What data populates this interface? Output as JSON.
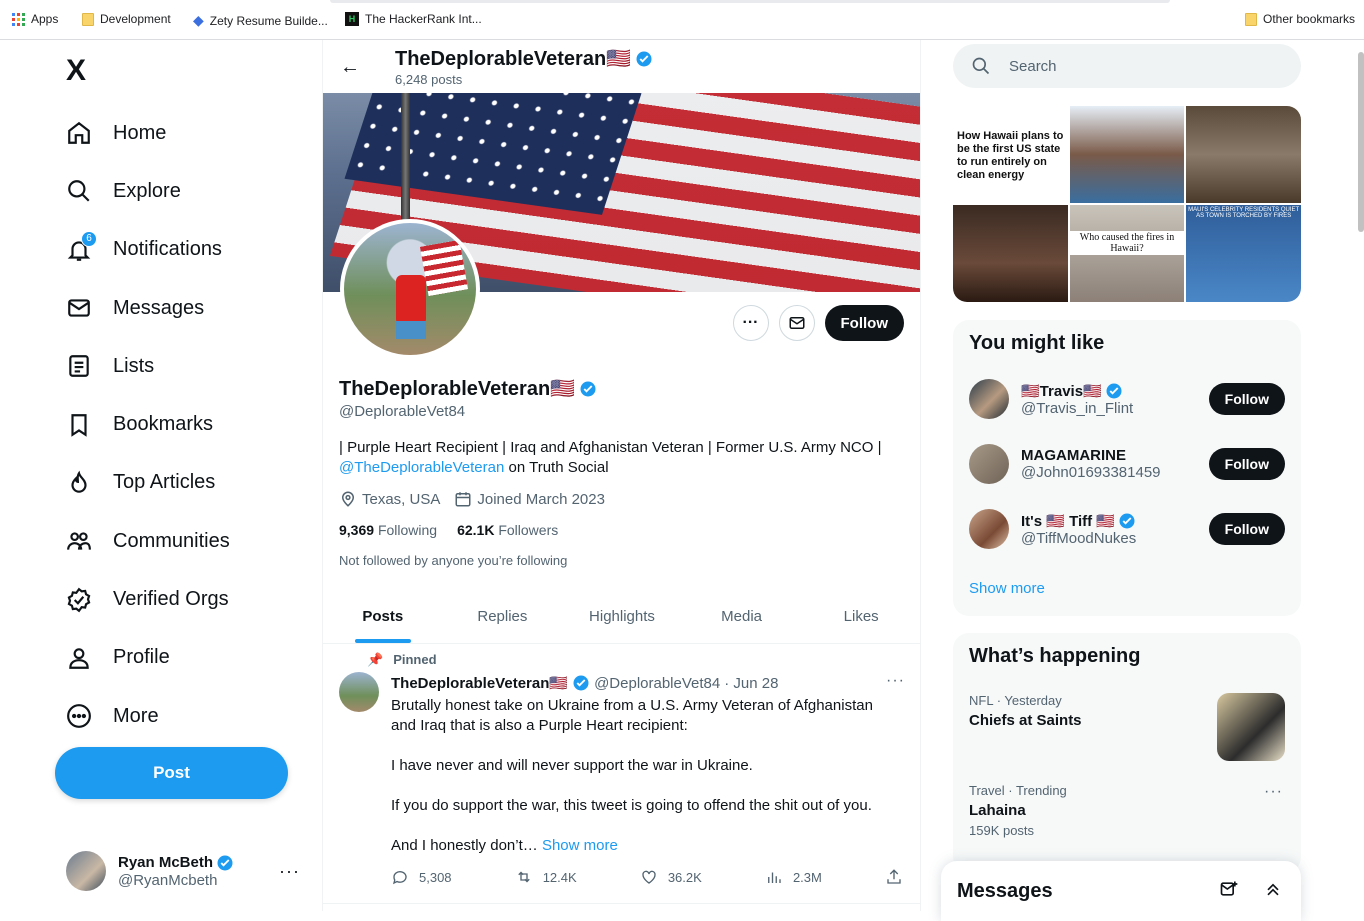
{
  "bookmarks": {
    "apps": "Apps",
    "items": [
      "Development",
      "Zety Resume Builde...",
      "The HackerRank Int..."
    ],
    "other": "Other bookmarks"
  },
  "sidebar": {
    "logo": "X",
    "nav": [
      {
        "label": "Home",
        "icon": "home-icon"
      },
      {
        "label": "Explore",
        "icon": "search-icon"
      },
      {
        "label": "Notifications",
        "icon": "bell-icon",
        "badge": "6"
      },
      {
        "label": "Messages",
        "icon": "mail-icon"
      },
      {
        "label": "Lists",
        "icon": "list-icon"
      },
      {
        "label": "Bookmarks",
        "icon": "bookmark-icon"
      },
      {
        "label": "Top Articles",
        "icon": "flame-icon"
      },
      {
        "label": "Communities",
        "icon": "people-icon"
      },
      {
        "label": "Verified Orgs",
        "icon": "verified-badge-icon"
      },
      {
        "label": "Profile",
        "icon": "person-icon"
      },
      {
        "label": "More",
        "icon": "more-circle-icon"
      }
    ],
    "post_label": "Post",
    "account": {
      "name": "Ryan McBeth",
      "handle": "@RyanMcbeth"
    }
  },
  "header": {
    "name": "TheDeplorableVeteran🇺🇸",
    "posts": "6,248 posts"
  },
  "profile": {
    "name": "TheDeplorableVeteran🇺🇸",
    "handle": "@DeplorableVet84",
    "bio_line1": "| Purple Heart Recipient | Iraq and Afghanistan Veteran | Former U.S. Army NCO |",
    "bio_link": "@TheDeplorableVeteran",
    "bio_suffix": " on Truth Social",
    "location": "Texas, USA",
    "joined": "Joined March 2023",
    "following_count": "9,369",
    "following_label": "Following",
    "followers_count": "62.1K",
    "followers_label": "Followers",
    "not_followed": "Not followed by anyone you’re following",
    "follow_label": "Follow"
  },
  "tabs": [
    "Posts",
    "Replies",
    "Highlights",
    "Media",
    "Likes"
  ],
  "tweet": {
    "pinned": "Pinned",
    "name": "TheDeplorableVeteran🇺🇸",
    "handle": "@DeplorableVet84",
    "date": "· Jun 28",
    "text": "Brutally honest take on Ukraine from a U.S. Army Veteran of Afghanistan and Iraq that is also a Purple Heart recipient:\n\nI have never and will never support the war in Ukraine.\n\nIf you do support the war, this tweet is going to offend the shit out of you.\n\nAnd I honestly don’t…",
    "show_more": "Show more",
    "replies": "5,308",
    "reposts": "12.4K",
    "likes": "36.2K",
    "views": "2.3M"
  },
  "right": {
    "search_placeholder": "Search",
    "media_text1": "How Hawaii plans to be the first US state to run entirely on clean energy",
    "media_text2": "Who caused the fires in Hawaii?",
    "media_text3": "MAUI'S CELEBRITY RESIDENTS QUIET AS TOWN IS TORCHED BY FIRES",
    "wtf_title": "You might like",
    "wtf": [
      {
        "name": "🇺🇸Travis🇺🇸",
        "handle": "@Travis_in_Flint",
        "verified": true
      },
      {
        "name": "MAGAMARINE",
        "handle": "@John01693381459",
        "verified": false
      },
      {
        "name": "It's 🇺🇸 Tiff 🇺🇸",
        "handle": "@TiffMoodNukes",
        "verified": true
      }
    ],
    "follow_label": "Follow",
    "show_more": "Show more",
    "happening_title": "What’s happening",
    "trends": [
      {
        "cat": "NFL · Yesterday",
        "title": "Chiefs at Saints",
        "count": ""
      },
      {
        "cat": "Travel · Trending",
        "title": "Lahaina",
        "count": "159K posts"
      }
    ],
    "messages_title": "Messages"
  },
  "colors": {
    "accent": "#1d9bf0",
    "text": "#0f1419",
    "muted": "#536471"
  }
}
